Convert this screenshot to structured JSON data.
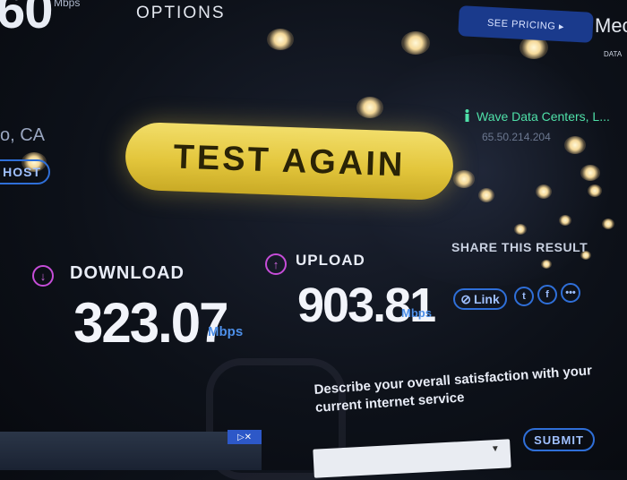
{
  "top_speed": {
    "value": "60",
    "unit": "Mbps"
  },
  "header": {
    "options_label": "OPTIONS",
    "pricing_label": "SEE PRICING ▸",
    "media_fragment": "Mec",
    "data_fragment": "DATA"
  },
  "location_fragment": "o, CA",
  "host_button_label": "HOST",
  "test_again_label": "TEST AGAIN",
  "server": {
    "name": "Wave Data Centers, L...",
    "ip": "65.50.214.204"
  },
  "download": {
    "label": "DOWNLOAD",
    "value": "323.07",
    "unit": "Mbps"
  },
  "upload": {
    "label": "UPLOAD",
    "value": "903.81",
    "unit": "Mbps"
  },
  "share": {
    "title": "SHARE THIS RESULT",
    "link_label": "Link",
    "twitter_icon": "t",
    "facebook_icon": "f",
    "more_icon": "•••"
  },
  "survey": {
    "prompt": "Describe your overall satisfaction with your current internet service",
    "submit_label": "SUBMIT"
  },
  "ad_icons": "▷✕",
  "colors": {
    "accent_yellow": "#e3c63c",
    "accent_blue": "#2f6fd8",
    "accent_purple": "#c64dd8",
    "server_green": "#4fe0a8"
  }
}
